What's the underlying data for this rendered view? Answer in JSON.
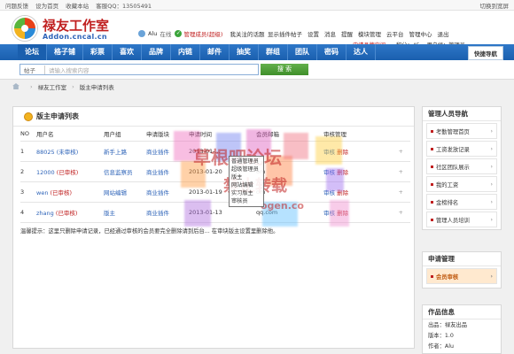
{
  "topbar": {
    "left": [
      "问题反馈",
      "设为首页",
      "收藏本站",
      "客服QQ：13505491"
    ],
    "right": "切换到宽屏"
  },
  "header": {
    "logo_title": "禄友工作室",
    "logo_sub": "Addon.cncal.cn",
    "user": {
      "name": "Alu",
      "status": "在线",
      "role": "管理成员(超级)",
      "follow": "我关注的话题"
    },
    "nav": [
      "显示插件帖子",
      "设置",
      "消息",
      "提醒",
      "模块管理",
      "云平台",
      "管理中心",
      "退出"
    ],
    "line2": {
      "apply": "申请品牌空间",
      "points_label": "积分：45",
      "group_label": "用户组：管理员"
    }
  },
  "mainnav": {
    "items": [
      "论坛",
      "格子铺",
      "彩票",
      "喜欢",
      "品牌",
      "内链",
      "邮件",
      "抽奖",
      "群组",
      "团队",
      "密码",
      "达人"
    ],
    "quick": "快捷导航"
  },
  "search": {
    "category": "帖子",
    "placeholder": "请输入搜索内容",
    "button": "搜 索"
  },
  "breadcrumb": [
    "禄友工作室",
    "版主申请列表"
  ],
  "panel": {
    "title": "版主申请列表",
    "headers": [
      "NO",
      "用户名",
      "用户组",
      "申请版块",
      "申请时间",
      "会员邮箱",
      "审核管理"
    ],
    "rows": [
      {
        "no": "1",
        "user": "88025",
        "state": "(未审核)",
        "group": "新手上路",
        "forum": "商业插件",
        "time": "2013-01-...",
        "email": "",
        "op": "审核",
        "del": "删除"
      },
      {
        "no": "2",
        "user": "12000",
        "state": "(已审核)",
        "group": "信息监察员",
        "forum": "商业插件",
        "time": "2013-01-20",
        "email": "om",
        "op": "审核",
        "del": "删除"
      },
      {
        "no": "3",
        "user": "wen",
        "state": "(已审核)",
        "group": "网站编辑",
        "forum": "商业插件",
        "time": "2013-01-19",
        "email": "om",
        "op": "审核",
        "del": "删除"
      },
      {
        "no": "4",
        "user": "zhang",
        "state": "(已审核)",
        "group": "版主",
        "forum": "商业插件",
        "time": "2013-01-13",
        "email": "qq.com",
        "op": "审核",
        "del": "删除"
      }
    ],
    "tip": "温馨提示：这里只删除申请记录，已经通过审核的会员要完全删除请到后台... 在审块版主设置里删除他。"
  },
  "overlay": {
    "watermark1": "草根吧论坛",
    "watermark2": "禁止转载",
    "watermark3": "ogen.co",
    "popup": [
      "普通管理员",
      "超级管理员",
      "版主",
      "网站编辑",
      "实习版主",
      "审核员"
    ]
  },
  "side1": {
    "title": "管理人员导航",
    "items": [
      "考勤管理首页",
      "工资发放记录",
      "社区团队展示",
      "我的工资",
      "金榜排名",
      "管理人员培训"
    ]
  },
  "side2": {
    "title": "申请管理",
    "items": [
      "会员审核"
    ]
  },
  "side3": {
    "title": "作品信息",
    "lines": [
      "出品：禄友出品",
      "版本：1.0",
      "作者：Alu"
    ]
  }
}
